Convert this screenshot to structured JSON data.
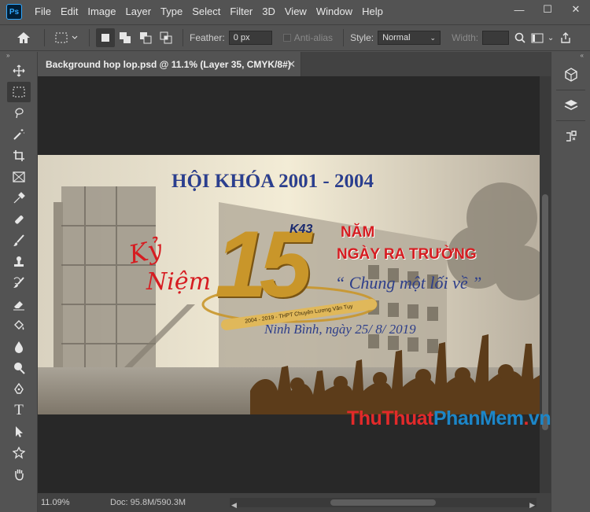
{
  "app": {
    "logo_text": "Ps",
    "menu": [
      "File",
      "Edit",
      "Image",
      "Layer",
      "Type",
      "Select",
      "Filter",
      "3D",
      "View",
      "Window",
      "Help"
    ],
    "window_controls": {
      "minimize": "—",
      "maximize": "☐",
      "close": "✕"
    }
  },
  "options_bar": {
    "feather_label": "Feather:",
    "feather_value": "0 px",
    "antialias_label": "Anti-alias",
    "style_label": "Style:",
    "style_value": "Normal",
    "width_label": "Width:"
  },
  "document": {
    "tab_title": "Background hop lop.psd @ 11.1% (Layer 35, CMYK/8#)",
    "tab_close": "✕"
  },
  "artwork": {
    "title": "HỘI KHÓA 2001 - 2004",
    "ky": "Kỷ",
    "niem": "Niệm",
    "big_number": "15",
    "k43": "K43",
    "nam": "NĂM",
    "ngay_ra_truong": "NGÀY RA TRƯỜNG",
    "slogan": "“ Chung một lối về ”",
    "ribbon": "2004 - 2019 - THPT Chuyên Lương Văn Tụy",
    "date_line": "Ninh Bình, ngày 25/ 8/ 2019"
  },
  "watermark": {
    "part1": "Thu",
    "part2": "Thuat",
    "part3": "Phan",
    "part4": "Mem",
    "part5": ".",
    "part6": "vn"
  },
  "status": {
    "zoom": "11.09%",
    "doc_size": "Doc: 95.8M/590.3M",
    "chevron": "›"
  },
  "colors": {
    "ui_bg": "#535353",
    "canvas_bg": "#282828",
    "title_blue": "#2b3f8f",
    "accent_red": "#d61c21",
    "gold": "#c9962a"
  }
}
